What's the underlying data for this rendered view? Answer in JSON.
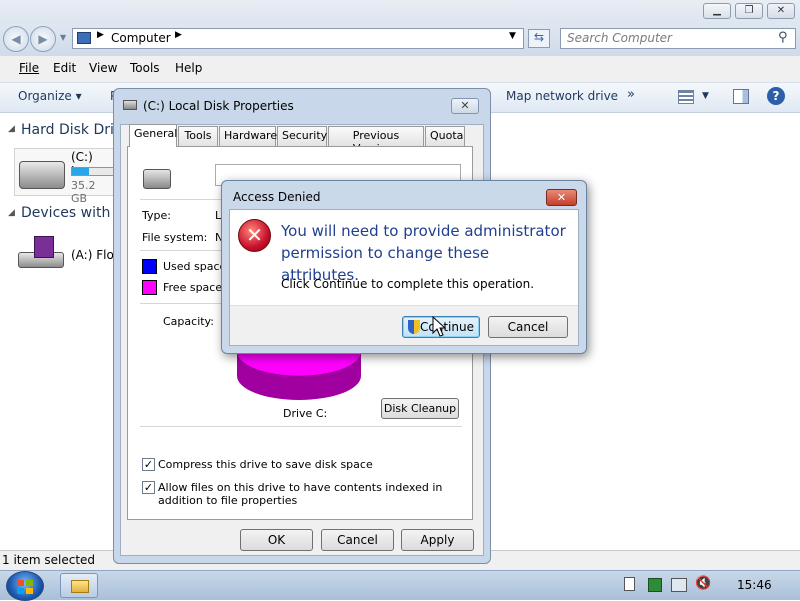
{
  "explorer": {
    "address_location": "Computer",
    "search_placeholder": "Search Computer",
    "menu": [
      "File",
      "Edit",
      "View",
      "Tools",
      "Help"
    ],
    "toolbar": {
      "organize": "Organize ▾",
      "properties_partial": "P",
      "map_network": "Map network drive",
      "more": "»"
    },
    "groups": {
      "hard_disk": "Hard Disk Driv",
      "devices": "Devices with R"
    },
    "drive_c": {
      "label": "(C:) Loc",
      "size": "35.2 GB"
    },
    "floppy": {
      "label": "(A:) Flop"
    },
    "status": "1 item selected"
  },
  "props": {
    "title": "(C:) Local Disk Properties",
    "tabs": [
      "General",
      "Tools",
      "Hardware",
      "Security",
      "Previous Versions",
      "Quota"
    ],
    "type_label": "Type:",
    "type_value_partial": "L",
    "fs_label": "File system:",
    "fs_value_partial": "N",
    "used_label": "Used space",
    "free_label": "Free space:",
    "capacity_label": "Capacity:",
    "drive_caption": "Drive C:",
    "disk_cleanup": "Disk Cleanup",
    "compress": "Compress this drive to save disk space",
    "index": "Allow files on this drive to have contents indexed in addition to file properties",
    "ok": "OK",
    "cancel": "Cancel",
    "apply": "Apply",
    "colors": {
      "used": "#0000ff",
      "free": "#ff00ff"
    }
  },
  "dialog": {
    "title": "Access Denied",
    "message": "You will need to provide administrator permission to change these attributes.",
    "detail": "Click Continue to complete this operation.",
    "continue": "Continue",
    "cancel": "Cancel"
  },
  "taskbar": {
    "clock": "15:46"
  }
}
